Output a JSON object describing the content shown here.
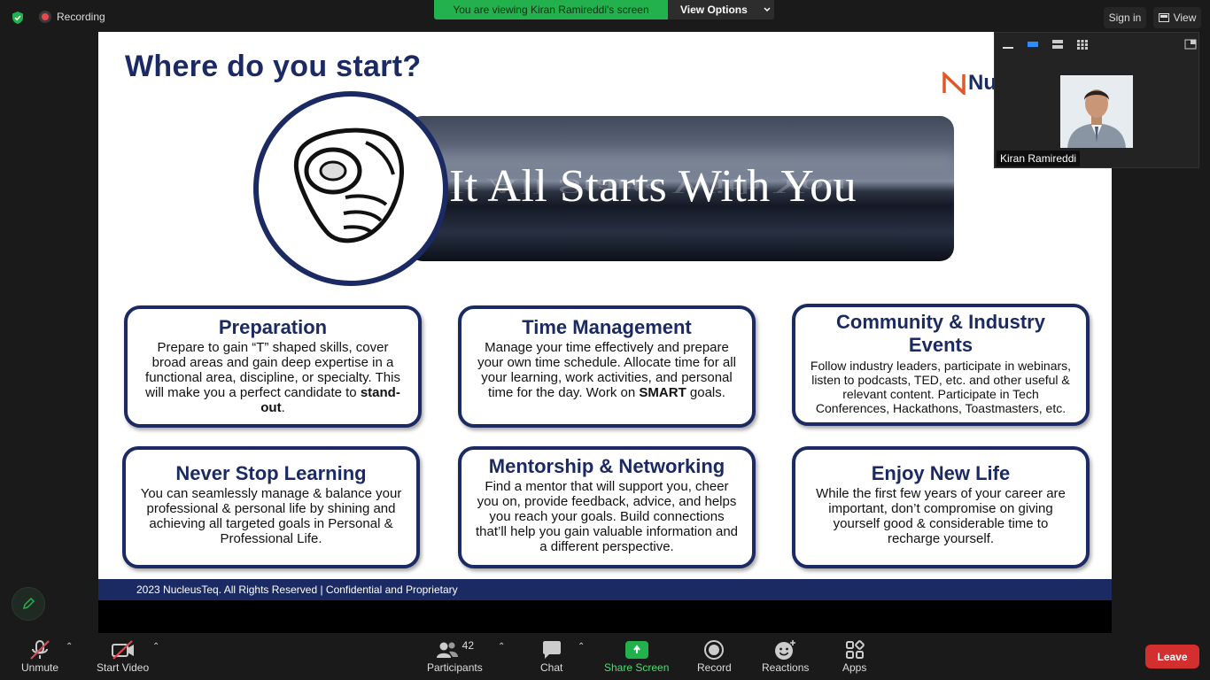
{
  "topbar": {
    "recording_label": "Recording",
    "viewing_banner": "You are viewing Kiran Ramireddi's screen",
    "view_options_label": "View Options",
    "sign_in_label": "Sign in",
    "view_label": "View"
  },
  "slide": {
    "title": "Where do you start?",
    "logo_text": "Nu",
    "banner_text": "It All Starts With You",
    "footer_text": "2023 NucleusTeq. All Rights Reserved | Confidential and Proprietary",
    "boxes": [
      {
        "title": "Preparation",
        "body": "Prepare to gain “T” shaped skills, cover broad areas and gain deep expertise in a functional area, discipline, or specialty. This will make you a perfect candidate to ",
        "bold": "stand-out",
        "tail": "."
      },
      {
        "title": "Time Management",
        "body": "Manage your time effectively and prepare your own time schedule. Allocate time for all your learning, work activities, and personal time for the day. Work on ",
        "bold": "SMART",
        "tail": " goals."
      },
      {
        "title": "Community & Industry Events",
        "body": "Follow industry leaders, participate in webinars, listen to podcasts, TED, etc. and other useful & relevant content. Participate in Tech Conferences, Hackathons, Toastmasters, etc."
      },
      {
        "title": "Never Stop Learning",
        "body": "You can seamlessly manage & balance your professional & personal life by shining and achieving all targeted goals in Personal & Professional Life."
      },
      {
        "title": "Mentorship & Networking",
        "body": "Find a mentor that will support you, cheer you on, provide feedback, advice, and helps you reach your goals. Build connections that’ll help you gain valuable information and a different perspective."
      },
      {
        "title": "Enjoy New Life",
        "body": "While the first few years of your career are important, don’t compromise on giving yourself good & considerable time to recharge yourself."
      }
    ]
  },
  "participant_tile": {
    "name": "Kiran Ramireddi"
  },
  "toolbar": {
    "unmute": "Unmute",
    "start_video": "Start Video",
    "participants": "Participants",
    "participant_count": "42",
    "chat": "Chat",
    "share_screen": "Share Screen",
    "record": "Record",
    "reactions": "Reactions",
    "apps": "Apps",
    "leave": "Leave"
  },
  "colors": {
    "accent_green": "#23b14d",
    "slide_navy": "#1b2a63",
    "leave_red": "#d32f2f"
  }
}
